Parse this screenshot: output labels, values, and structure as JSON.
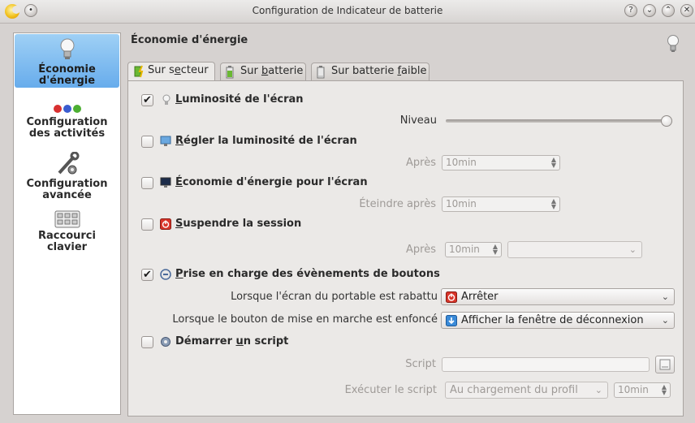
{
  "window": {
    "title": "Configuration de Indicateur de batterie",
    "buttons": [
      "?",
      "⌄",
      "⌃",
      "✕"
    ]
  },
  "sidebar": {
    "items": [
      {
        "label": "Économie d'énergie",
        "icon": "lightbulb-icon",
        "selected": true
      },
      {
        "label": "Configuration des activités",
        "icon": "activities-icon",
        "selected": false
      },
      {
        "label": "Configuration avancée",
        "icon": "tools-icon",
        "selected": false
      },
      {
        "label": "Raccourci clavier",
        "icon": "keyboard-icon",
        "selected": false
      }
    ]
  },
  "header": {
    "title": "Économie d'énergie"
  },
  "tabs": [
    {
      "label_pre": "Sur s",
      "label_u": "e",
      "label_post": "cteur",
      "active": true
    },
    {
      "label_pre": "Sur ",
      "label_u": "b",
      "label_post": "atterie",
      "active": false
    },
    {
      "label_pre": "Sur batterie ",
      "label_u": "f",
      "label_post": "aible",
      "active": false
    }
  ],
  "options": {
    "brightness": {
      "u": "L",
      "rest": "uminosité de l'écran",
      "checked": true,
      "level_label": "Niveau",
      "level": 1.0
    },
    "dim": {
      "u": "R",
      "rest": "égler la luminosité de l'écran",
      "checked": false,
      "after_label": "Après",
      "value": "10min"
    },
    "screen": {
      "u": "É",
      "rest": "conomie d'énergie pour l'écran",
      "checked": false,
      "after_label": "Éteindre après",
      "value": "10min"
    },
    "suspend": {
      "u": "S",
      "rest": "uspendre la session",
      "checked": false,
      "after_label": "Après",
      "value": "10min",
      "action": ""
    },
    "buttons": {
      "u": "P",
      "rest": "rise en charge des évènements de boutons",
      "checked": true,
      "lid_label": "Lorsque l'écran du portable est rabattu",
      "lid_value": "Arrêter",
      "power_label": "Lorsque le bouton de mise en marche est enfoncé",
      "power_value": "Afficher la fenêtre de déconnexion"
    },
    "script": {
      "pre": "Démarrer ",
      "u": "u",
      "post": "n script",
      "checked": false,
      "script_label": "Script",
      "script_value": "",
      "run_label": "Exécuter le script",
      "run_value": "Au chargement du profil",
      "run_time": "10min"
    }
  }
}
